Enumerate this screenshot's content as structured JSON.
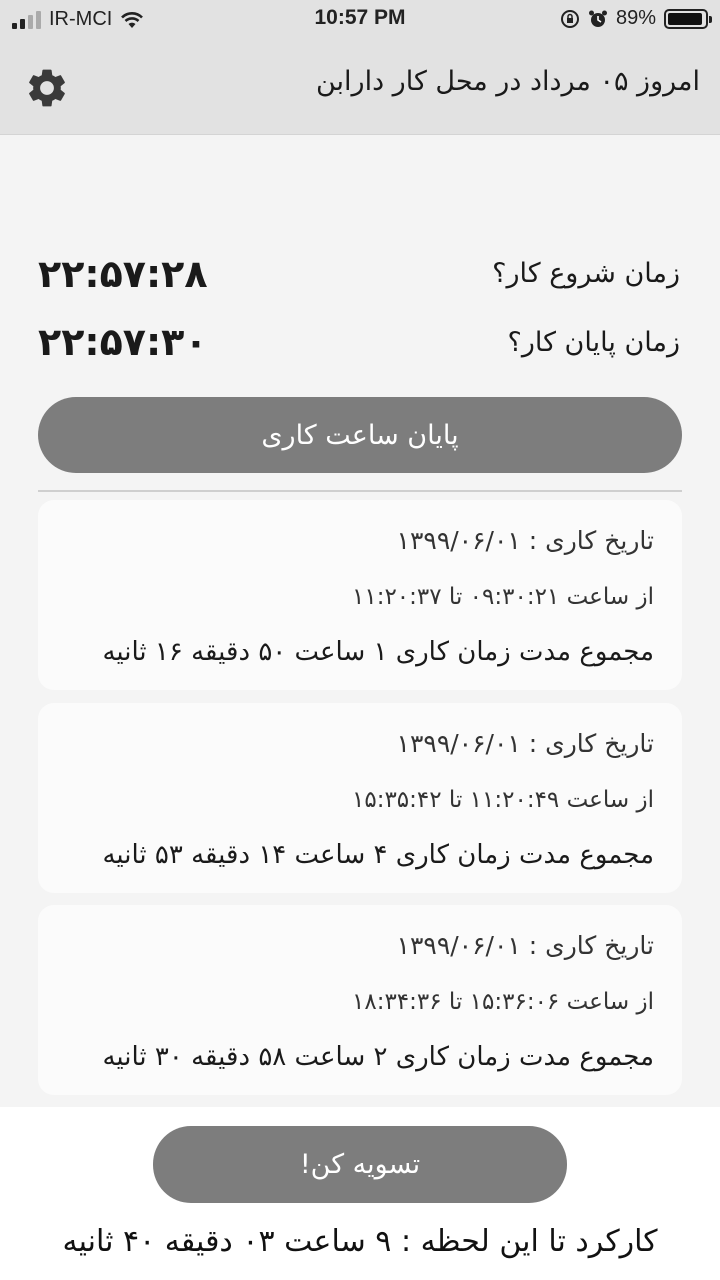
{
  "status_bar": {
    "carrier": "IR-MCI",
    "time": "10:57 PM",
    "battery": "89%"
  },
  "header": {
    "title": "امروز ۰۵ مرداد در محل کار دارابن"
  },
  "work": {
    "start_label": "زمان شروع کار؟",
    "start_time": "۲۲:۵۷:۲۸",
    "end_label": "زمان پایان کار؟",
    "end_time": "۲۲:۵۷:۳۰",
    "end_button": "پایان ساعت کاری"
  },
  "records": [
    {
      "date_line": "تاریخ کاری : ۱۳۹۹/۰۶/۰۱",
      "range_line": "از ساعت ۰۹:۳۰:۲۱ تا ۱۱:۲۰:۳۷",
      "total_line": "مجموع مدت زمان کاری ۱ ساعت ۵۰ دقیقه ۱۶ ثانیه"
    },
    {
      "date_line": "تاریخ کاری : ۱۳۹۹/۰۶/۰۱",
      "range_line": "از ساعت ۱۱:۲۰:۴۹ تا ۱۵:۳۵:۴۲",
      "total_line": "مجموع مدت زمان کاری ۴ ساعت ۱۴ دقیقه ۵۳ ثانیه"
    },
    {
      "date_line": "تاریخ کاری : ۱۳۹۹/۰۶/۰۱",
      "range_line": "از ساعت ۱۵:۳۶:۰۶ تا ۱۸:۳۴:۳۶",
      "total_line": "مجموع مدت زمان کاری ۲ ساعت ۵۸ دقیقه ۳۰ ثانیه"
    }
  ],
  "footer": {
    "settle_button": "تسویه کن!",
    "total_text": "کارکرد تا این لحظه : ۹ ساعت ۰۳ دقیقه ۴۰ ثانیه"
  },
  "icons": {
    "settings": "gear-icon",
    "wifi": "wifi-icon",
    "signal": "signal-icon",
    "alarm": "alarm-icon",
    "orientation_lock": "orientation-lock-icon",
    "battery": "battery-icon"
  },
  "colors": {
    "button_gray": "#7d7d7d",
    "header_bg": "#e2e2e2",
    "card_bg": "#fbfbfb",
    "page_bg": "#f4f4f4"
  }
}
